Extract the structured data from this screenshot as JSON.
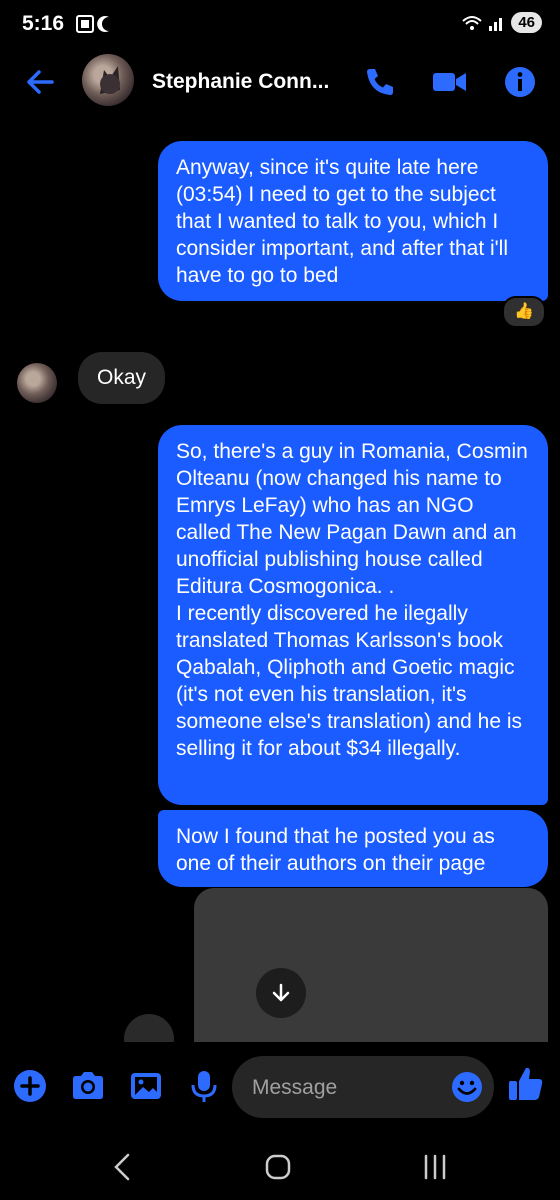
{
  "status_bar": {
    "time": "5:16",
    "battery": "46"
  },
  "header": {
    "contact_name": "Stephanie Conn..."
  },
  "messages": [
    {
      "type": "outgoing",
      "text": "Anyway, since it's quite late here (03:54) I need to get to the subject that I wanted to talk to you, which I consider important, and after that i'll have to go to bed",
      "reaction": "👍"
    },
    {
      "type": "incoming",
      "text": "Okay"
    },
    {
      "type": "outgoing",
      "text": "So, there's a guy in Romania, Cosmin Olteanu (now changed his name to Emrys LeFay) who has an NGO called The New Pagan Dawn and an unofficial publishing house called Editura Cosmogonica. .\nI recently discovered he ilegally translated Thomas Karlsson's book Qabalah, Qliphoth and Goetic magic (it's not even his translation, it's someone else's translation) and he is selling it for about $34 illegally."
    },
    {
      "type": "outgoing",
      "text": "Now I found that he posted you as one of their authors on their page"
    }
  ],
  "composer": {
    "placeholder": "Message"
  },
  "colors": {
    "accent": "#1a5cff",
    "bubble_out": "#1a5cff",
    "bubble_in": "#262626"
  }
}
